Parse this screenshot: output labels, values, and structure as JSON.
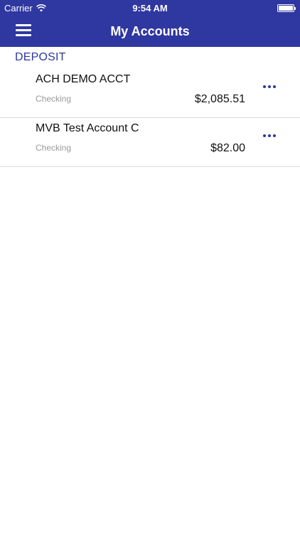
{
  "status_bar": {
    "carrier": "Carrier",
    "time": "9:54 AM"
  },
  "nav": {
    "title": "My Accounts"
  },
  "section": {
    "title": "DEPOSIT"
  },
  "accounts": [
    {
      "name": "ACH DEMO ACCT",
      "type": "Checking",
      "balance": "$2,085.51"
    },
    {
      "name": "MVB Test Account C",
      "type": "Checking",
      "balance": "$82.00"
    }
  ],
  "colors": {
    "accent": "#2f37a0"
  },
  "icons": {
    "menu": "hamburger-menu-icon",
    "more": "more-ellipsis-icon",
    "wifi": "wifi-icon",
    "battery": "battery-icon"
  }
}
